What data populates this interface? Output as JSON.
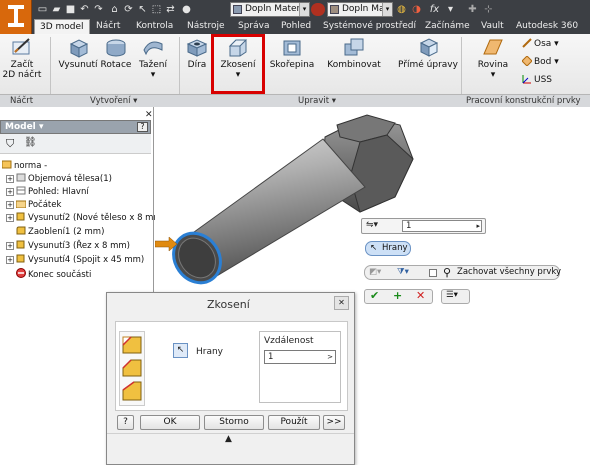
{
  "quick_access": {
    "material_combo": "Dopln Materiál",
    "appearance_combo": "Dopln Mater"
  },
  "tabs": [
    "3D model",
    "Náčrt",
    "Kontrola",
    "Nástroje",
    "Správa",
    "Pohled",
    "Systémové prostředí",
    "Začínáme",
    "Vault",
    "Autodesk 360"
  ],
  "active_tab": "3D model",
  "ribbon": {
    "sketch": {
      "label": "Začít 2D náčrt",
      "label2": "2D náčrt",
      "label1": "Začít"
    },
    "create": {
      "extrude": "Vysunutí",
      "revolve": "Rotace",
      "sweep": "Tažení"
    },
    "modify": {
      "hole": "Díra",
      "chamfer": "Zkosení",
      "shell": "Skořepina",
      "combine": "Kombinovat",
      "direct": "Přímé úpravy"
    },
    "work": {
      "plane": "Rovina",
      "axis": "Osa",
      "point": "Bod",
      "ucs": "USS"
    },
    "panels": {
      "sketch": "Náčrt",
      "create": "Vytvoření",
      "modify": "Upravit",
      "work": "Pracovní konstrukční prvky"
    }
  },
  "model_panel": {
    "title": "Model",
    "help": "?",
    "tree": [
      {
        "label": "norma -",
        "indent": 0
      },
      {
        "label": "Objemová tělesa(1)",
        "indent": 1
      },
      {
        "label": "Pohled: Hlavní",
        "indent": 1
      },
      {
        "label": "Počátek",
        "indent": 1
      },
      {
        "label": "Vysunutí2 (Nové těleso x 8 mm)",
        "indent": 1
      },
      {
        "label": "Zaoblení1 (2 mm)",
        "indent": 1
      },
      {
        "label": "Vysunutí3 (Řez x 8 mm)",
        "indent": 1
      },
      {
        "label": "Vysunutí4 (Spojit x 45 mm)",
        "indent": 1
      },
      {
        "label": "Konec součásti",
        "indent": 1
      }
    ]
  },
  "minitoolbar": {
    "distance": "1",
    "edges_button": "Hrany",
    "keep_all": "Zachovat všechny prvky"
  },
  "dialog": {
    "title": "Zkosení",
    "edges_label": "Hrany",
    "distance_label": "Vzdálenost",
    "distance_value": "1",
    "ok": "OK",
    "cancel": "Storno",
    "apply": "Použít",
    "more": ">>",
    "help": "?"
  },
  "colors": {
    "highlight_box": "#d80000",
    "app_button": "#d8680c",
    "selection_blue": "#2a7fd4"
  }
}
